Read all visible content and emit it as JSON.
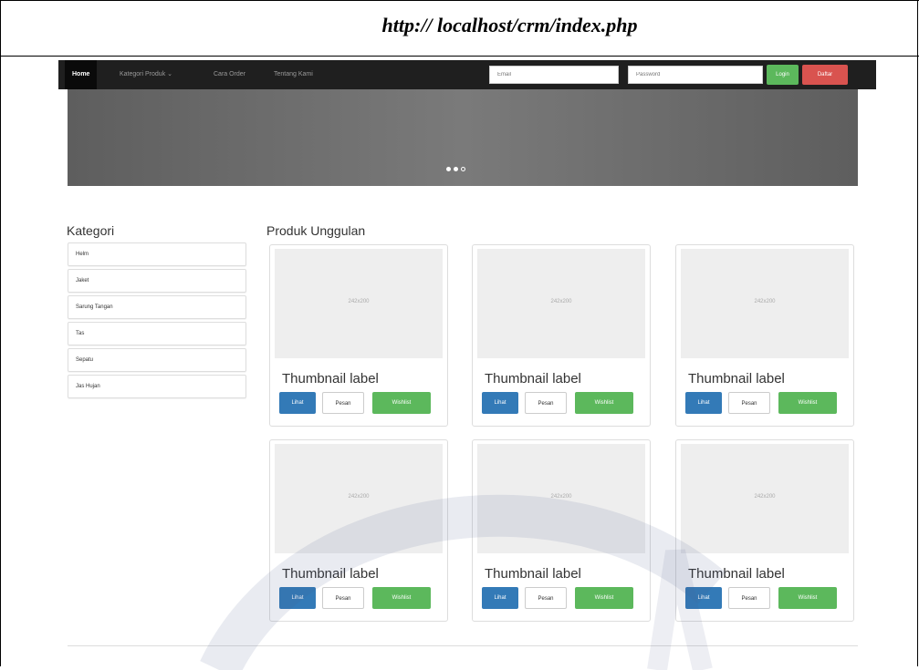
{
  "url": "http:// localhost/crm/index.php",
  "nav": {
    "home": "Home",
    "kategori": "Kategori Produk ⌄",
    "cara_order": "Cara Order",
    "tentang": "Tentang Kami",
    "email_placeholder": "Email",
    "password_placeholder": "Password",
    "login": "Login",
    "daftar": "Daftar"
  },
  "carousel": {
    "indicators": 3,
    "active": 0
  },
  "sidebar": {
    "title": "Kategori",
    "items": [
      "Helm",
      "Jaket",
      "Sarung Tangan",
      "Tas",
      "Sepatu",
      "Jas Hujan"
    ]
  },
  "main": {
    "title": "Produk Unggulan",
    "products": [
      {
        "image_text": "242x200",
        "label": "Thumbnail label",
        "lihat": "Lihat",
        "pesan": "Pesan",
        "wishlist": "Wishlist"
      },
      {
        "image_text": "242x200",
        "label": "Thumbnail label",
        "lihat": "Lihat",
        "pesan": "Pesan",
        "wishlist": "Wishlist"
      },
      {
        "image_text": "242x200",
        "label": "Thumbnail label",
        "lihat": "Lihat",
        "pesan": "Pesan",
        "wishlist": "Wishlist"
      },
      {
        "image_text": "242x200",
        "label": "Thumbnail label",
        "lihat": "Lihat",
        "pesan": "Pesan",
        "wishlist": "Wishlist"
      },
      {
        "image_text": "242x200",
        "label": "Thumbnail label",
        "lihat": "Lihat",
        "pesan": "Pesan",
        "wishlist": "Wishlist"
      },
      {
        "image_text": "242x200",
        "label": "Thumbnail label",
        "lihat": "Lihat",
        "pesan": "Pesan",
        "wishlist": "Wishlist"
      }
    ]
  },
  "colors": {
    "navbar": "#1f1f1f",
    "login": "#5cb85c",
    "daftar": "#d9534f",
    "lihat": "#337ab7",
    "wishlist": "#5cb85c"
  }
}
